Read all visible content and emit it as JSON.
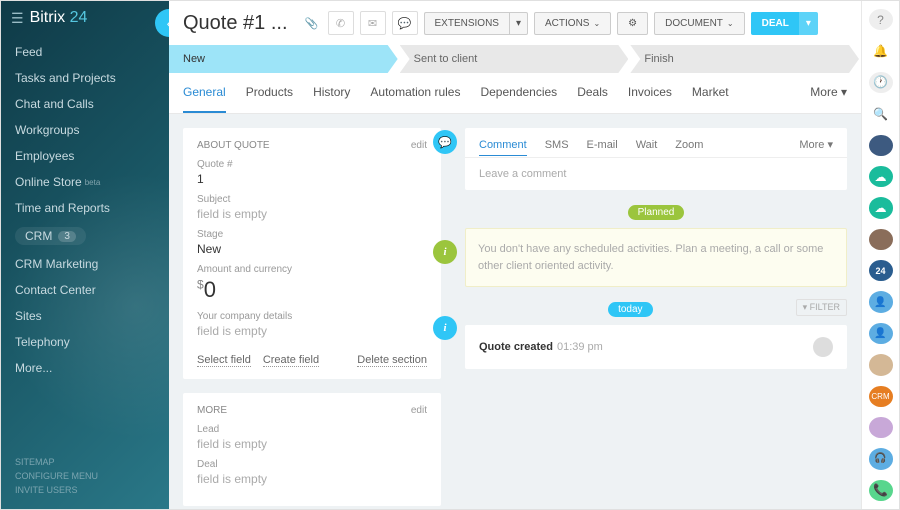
{
  "brand": {
    "name1": "Bitrix",
    "name2": "24"
  },
  "sidebar": {
    "items": [
      {
        "label": "Feed"
      },
      {
        "label": "Tasks and Projects"
      },
      {
        "label": "Chat and Calls"
      },
      {
        "label": "Workgroups"
      },
      {
        "label": "Employees"
      },
      {
        "label": "Online Store",
        "beta": "beta"
      },
      {
        "label": "Time and Reports"
      },
      {
        "label": "CRM",
        "badge": "3",
        "active": true
      },
      {
        "label": "CRM Marketing"
      },
      {
        "label": "Contact Center"
      },
      {
        "label": "Sites"
      },
      {
        "label": "Telephony"
      },
      {
        "label": "More..."
      }
    ],
    "footer": [
      "SITEMAP",
      "CONFIGURE MENU",
      "INVITE USERS"
    ]
  },
  "header": {
    "title": "Quote #1 ...",
    "buttons": {
      "extensions": "EXTENSIONS",
      "actions": "ACTIONS",
      "document": "DOCUMENT",
      "deal": "DEAL"
    }
  },
  "stages": [
    {
      "label": "New",
      "active": true
    },
    {
      "label": "Sent to client"
    },
    {
      "label": "Finish"
    }
  ],
  "tabs": [
    "General",
    "Products",
    "History",
    "Automation rules",
    "Dependencies",
    "Deals",
    "Invoices",
    "Market"
  ],
  "tabsMore": "More",
  "about": {
    "title": "ABOUT QUOTE",
    "edit": "edit",
    "quoteNumLabel": "Quote #",
    "quoteNum": "1",
    "subjectLabel": "Subject",
    "subject": "field is empty",
    "stageLabel": "Stage",
    "stage": "New",
    "amountLabel": "Amount and currency",
    "currency": "$",
    "amount": "0",
    "companyLabel": "Your company details",
    "company": "field is empty",
    "selectField": "Select field",
    "createField": "Create field",
    "deleteSection": "Delete section"
  },
  "more": {
    "title": "MORE",
    "edit": "edit",
    "leadLabel": "Lead",
    "lead": "field is empty",
    "dealLabel": "Deal",
    "deal": "field is empty"
  },
  "timeline": {
    "commentTabs": [
      "Comment",
      "SMS",
      "E-mail",
      "Wait",
      "Zoom"
    ],
    "commentMore": "More",
    "commentPlaceholder": "Leave a comment",
    "planned": "Planned",
    "noteText": "You don't have any scheduled activities. Plan a meeting, a call or some other client oriented activity.",
    "today": "today",
    "filter": "FILTER",
    "eventTitle": "Quote created",
    "eventTime": "01:39 pm"
  },
  "rightbar": {
    "label24": "24"
  }
}
